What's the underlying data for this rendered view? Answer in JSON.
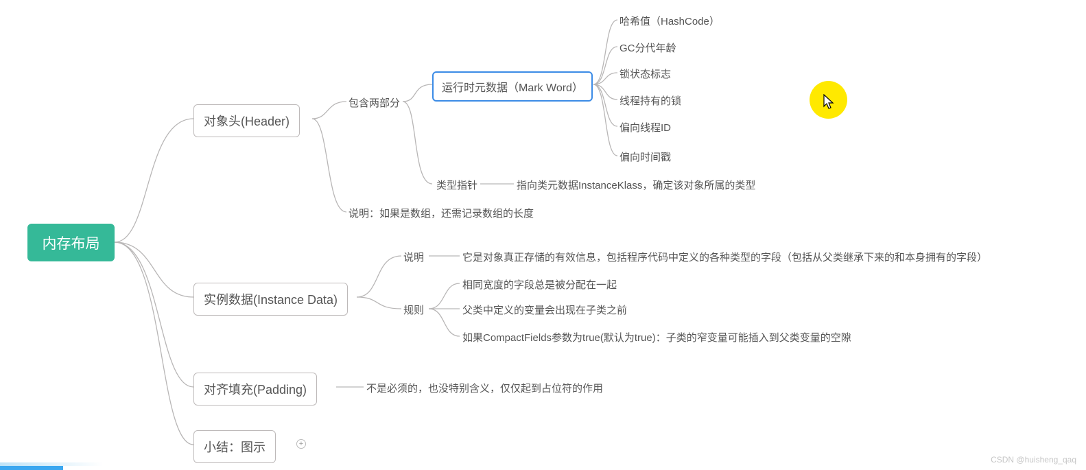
{
  "root": {
    "label": "内存布局"
  },
  "level1": {
    "header": {
      "label": "对象头(Header)"
    },
    "instance": {
      "label": "实例数据(Instance Data)"
    },
    "padding": {
      "label": "对齐填充(Padding)"
    },
    "summary": {
      "label": "小结：图示"
    }
  },
  "header_children": {
    "contain_label": "包含两部分",
    "mark_word": {
      "label": "运行时元数据（Mark Word）"
    },
    "type_ptr": {
      "label": "类型指针"
    },
    "type_ptr_desc": "指向类元数据InstanceKlass，确定该对象所属的类型",
    "array_note": "说明：如果是数组，还需记录数组的长度"
  },
  "mark_word_items": {
    "i0": "哈希值（HashCode）",
    "i1": "GC分代年龄",
    "i2": "锁状态标志",
    "i3": "线程持有的锁",
    "i4": "偏向线程ID",
    "i5": "偏向时间戳"
  },
  "instance_children": {
    "desc_label": "说明",
    "desc_text": "它是对象真正存储的有效信息，包括程序代码中定义的各种类型的字段（包括从父类继承下来的和本身拥有的字段）",
    "rule_label": "规则",
    "rules": {
      "r0": "相同宽度的字段总是被分配在一起",
      "r1": "父类中定义的变量会出现在子类之前",
      "r2": "如果CompactFields参数为true(默认为true)：子类的窄变量可能插入到父类变量的空隙"
    }
  },
  "padding_desc": "不是必须的，也没特别含义，仅仅起到占位符的作用",
  "watermark": "CSDN @huisheng_qaq"
}
